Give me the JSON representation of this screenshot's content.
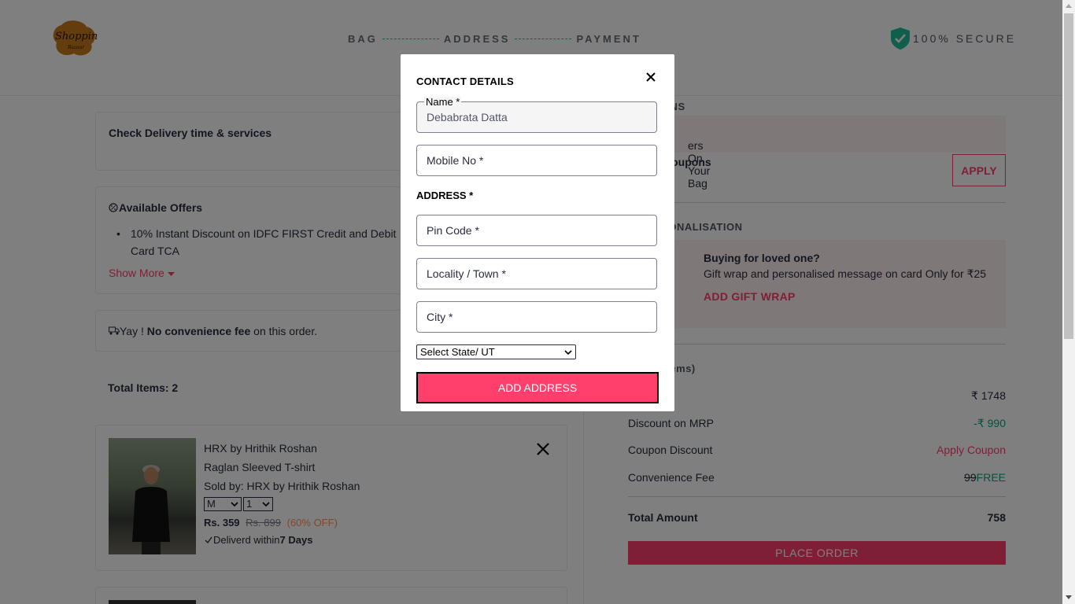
{
  "header": {
    "steps": [
      "BAG",
      "ADDRESS",
      "PAYMENT"
    ],
    "secure_label": "100% SECURE",
    "logo_text": "Shopping"
  },
  "left": {
    "delivery_title": "Check Delivery time & services",
    "offers_title": "Available Offers",
    "offers_items": [
      "10% Instant Discount on IDFC FIRST Credit and Debit Card TCA"
    ],
    "show_more": "Show More",
    "fee_prefix": "Yay ! ",
    "fee_bold": "No convenience fee",
    "fee_suffix": " on this order.",
    "total_items": "Total Items: 2",
    "product": {
      "brand": "HRX by Hrithik Roshan",
      "name": "Raglan Sleeved T-shirt",
      "seller": "Sold by: HRX by Hrithik Roshan",
      "size": "M",
      "qty": "1",
      "price": "Rs. 359",
      "mrp": "Rs. 899",
      "discount": "(60% OFF)",
      "delivery_prefix": "Deliverd within ",
      "delivery_days": "7 Days"
    }
  },
  "right": {
    "coupons_title": "& CUPONS",
    "coupon_banner": "ers On Your Bag",
    "apply_coupons_label": "Coupons",
    "apply_button": "APPLY",
    "gift_title": "& PERSONALISATION",
    "gift_heading": "Buying for loved one?",
    "gift_desc": "Gift wrap and personalised message on card Only for ₹25",
    "gift_action": "ADD GIFT WRAP",
    "price_title": "ails (2 Items)",
    "total_mrp_value": "₹ 1748",
    "discount_label": "Discount on MRP",
    "discount_value": "-₹ 990",
    "coupon_label": "Coupon Discount",
    "coupon_value": "Apply Coupon",
    "conv_label": "Convenience Fee",
    "conv_old": "99",
    "conv_new": "FREE",
    "total_label": "Total Amount",
    "total_value": "758",
    "place_order": "PLACE ORDER"
  },
  "modal": {
    "contact_title": "CONTACT DETAILS",
    "name_legend": "Name *",
    "name_value": "Debabrata Datta",
    "mobile_placeholder": "Mobile No *",
    "address_title": "ADDRESS *",
    "pin_placeholder": "Pin Code *",
    "locality_placeholder": "Locality / Town *",
    "city_placeholder": "City *",
    "state_select": "Select State/ UT",
    "add_button": "ADD ADDRESS"
  },
  "colors": {
    "accent": "#ff3f6c",
    "green": "#03a685",
    "shield": "#20bd99"
  }
}
